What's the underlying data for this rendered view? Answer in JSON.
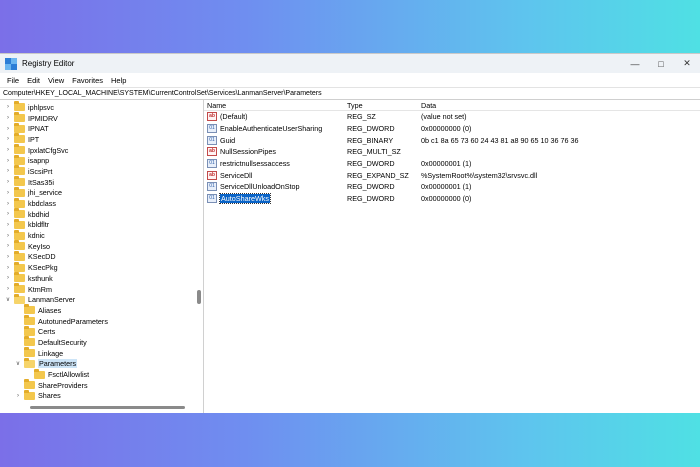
{
  "window": {
    "title": "Registry Editor"
  },
  "menu": [
    "File",
    "Edit",
    "View",
    "Favorites",
    "Help"
  ],
  "address": "Computer\\HKEY_LOCAL_MACHINE\\SYSTEM\\CurrentControlSet\\Services\\LanmanServer\\Parameters",
  "tree": [
    {
      "label": "iphlpsvc",
      "level": 1,
      "expandable": true
    },
    {
      "label": "IPMIDRV",
      "level": 1,
      "expandable": true
    },
    {
      "label": "IPNAT",
      "level": 1,
      "expandable": true
    },
    {
      "label": "IPT",
      "level": 1,
      "expandable": true
    },
    {
      "label": "IpxlatCfgSvc",
      "level": 1,
      "expandable": true
    },
    {
      "label": "isapnp",
      "level": 1,
      "expandable": true
    },
    {
      "label": "iScsiPrt",
      "level": 1,
      "expandable": true
    },
    {
      "label": "ItSas35i",
      "level": 1,
      "expandable": true
    },
    {
      "label": "jhi_service",
      "level": 1,
      "expandable": true
    },
    {
      "label": "kbdclass",
      "level": 1,
      "expandable": true
    },
    {
      "label": "kbdhid",
      "level": 1,
      "expandable": true
    },
    {
      "label": "kbldfltr",
      "level": 1,
      "expandable": true
    },
    {
      "label": "kdnic",
      "level": 1,
      "expandable": true
    },
    {
      "label": "KeyIso",
      "level": 1,
      "expandable": true
    },
    {
      "label": "KSecDD",
      "level": 1,
      "expandable": true
    },
    {
      "label": "KSecPkg",
      "level": 1,
      "expandable": true
    },
    {
      "label": "ksthunk",
      "level": 1,
      "expandable": true
    },
    {
      "label": "KtmRm",
      "level": 1,
      "expandable": true
    },
    {
      "label": "LanmanServer",
      "level": 1,
      "expandable": true,
      "expanded": true
    },
    {
      "label": "Aliases",
      "level": 2,
      "expandable": false
    },
    {
      "label": "AutotunedParameters",
      "level": 2,
      "expandable": false
    },
    {
      "label": "Certs",
      "level": 2,
      "expandable": false
    },
    {
      "label": "DefaultSecurity",
      "level": 2,
      "expandable": false
    },
    {
      "label": "Linkage",
      "level": 2,
      "expandable": false
    },
    {
      "label": "Parameters",
      "level": 2,
      "expandable": true,
      "expanded": true,
      "selected": true
    },
    {
      "label": "FsctlAllowlist",
      "level": 3,
      "expandable": false
    },
    {
      "label": "ShareProviders",
      "level": 2,
      "expandable": false
    },
    {
      "label": "Shares",
      "level": 2,
      "expandable": true
    }
  ],
  "columns": {
    "name": "Name",
    "type": "Type",
    "data": "Data"
  },
  "values": [
    {
      "name": "(Default)",
      "type": "REG_SZ",
      "data": "(value not set)",
      "icon": "string-value-icon",
      "kind": "sz"
    },
    {
      "name": "EnableAuthenticateUserSharing",
      "type": "REG_DWORD",
      "data": "0x00000000 (0)",
      "icon": "binary-value-icon",
      "kind": "bin"
    },
    {
      "name": "Guid",
      "type": "REG_BINARY",
      "data": "0b c1 8a 65 73 60 24 43 81 a8 90 65 10 36 76 36",
      "icon": "binary-value-icon",
      "kind": "bin"
    },
    {
      "name": "NullSessionPipes",
      "type": "REG_MULTI_SZ",
      "data": "",
      "icon": "string-value-icon",
      "kind": "sz"
    },
    {
      "name": "restrictnullsessaccess",
      "type": "REG_DWORD",
      "data": "0x00000001 (1)",
      "icon": "binary-value-icon",
      "kind": "bin"
    },
    {
      "name": "ServiceDll",
      "type": "REG_EXPAND_SZ",
      "data": "%SystemRoot%\\system32\\srvsvc.dll",
      "icon": "string-value-icon",
      "kind": "sz"
    },
    {
      "name": "ServiceDllUnloadOnStop",
      "type": "REG_DWORD",
      "data": "0x00000001 (1)",
      "icon": "binary-value-icon",
      "kind": "bin"
    },
    {
      "name": "AutoShareWks",
      "type": "REG_DWORD",
      "data": "0x00000000 (0)",
      "icon": "binary-value-icon",
      "kind": "bin",
      "selected": true
    }
  ],
  "colors": {
    "selection": "#0a64c8",
    "tree_selection": "#cce4f7",
    "folder": "#f3c74d"
  }
}
